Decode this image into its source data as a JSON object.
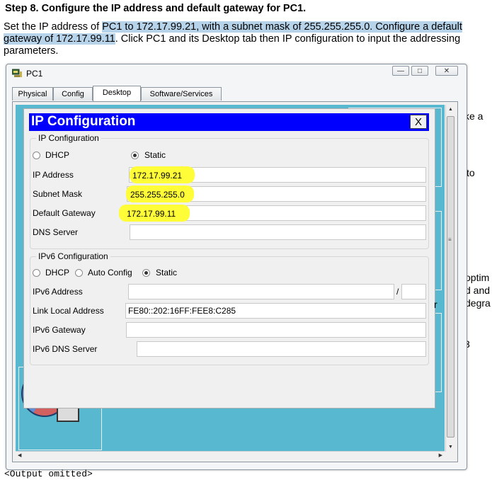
{
  "doc": {
    "heading": "Step 8. Configure the IP address and default gateway for PC1.",
    "para_plain1": "Set the IP address of ",
    "para_hl1": "PC1 to 172.17.99.21, with a subnet mask of 255.255.255.0. Configure a default gateway of 172.17.99.11",
    "para_plain2": ". Click PC1 and its Desktop tab then IP configuration to input the addressing parameters.",
    "side_text_1": "ke a",
    "side_text_2": "to",
    "side_text_3": "optim",
    "side_text_4": "d and",
    "side_text_5": "degra",
    "side_text_6": "r",
    "side_text_7": "3",
    "output_omitted": "<Output omitted>"
  },
  "window": {
    "title": "PC1",
    "icon": "pc-icon",
    "buttons": {
      "minimize": "—",
      "maximize": "□",
      "close": "✕"
    },
    "tabs": [
      {
        "label": "Physical",
        "active": false
      },
      {
        "label": "Config",
        "active": false
      },
      {
        "label": "Desktop",
        "active": true
      },
      {
        "label": "Software/Services",
        "active": false
      }
    ]
  },
  "dialog": {
    "title": "IP Configuration",
    "close_label": "X",
    "ipv4": {
      "group_title": "IP Configuration",
      "dhcp_label": "DHCP",
      "static_label": "Static",
      "selected": "Static",
      "ip_label": "IP Address",
      "ip_value": "172.17.99.21",
      "mask_label": "Subnet Mask",
      "mask_value": "255.255.255.0",
      "gateway_label": "Default Gateway",
      "gateway_value": "172.17.99.11",
      "dns_label": "DNS Server",
      "dns_value": ""
    },
    "ipv6": {
      "group_title": "IPv6 Configuration",
      "dhcp_label": "DHCP",
      "auto_label": "Auto Config",
      "static_label": "Static",
      "selected": "Static",
      "address_label": "IPv6 Address",
      "address_value": "",
      "prefix_separator": "/",
      "prefix_value": "",
      "link_local_label": "Link Local Address",
      "link_local_value": "FE80::202:16FF:FEE8:C285",
      "gateway_label": "IPv6 Gateway",
      "gateway_value": "",
      "dns_label": "IPv6 DNS Server",
      "dns_value": ""
    }
  },
  "colors": {
    "dialog_title_bar": "#0000ff",
    "desktop_bg": "#58b8d0",
    "doc_highlight": "#b7d3ea",
    "field_highlight": "#fffc38"
  }
}
